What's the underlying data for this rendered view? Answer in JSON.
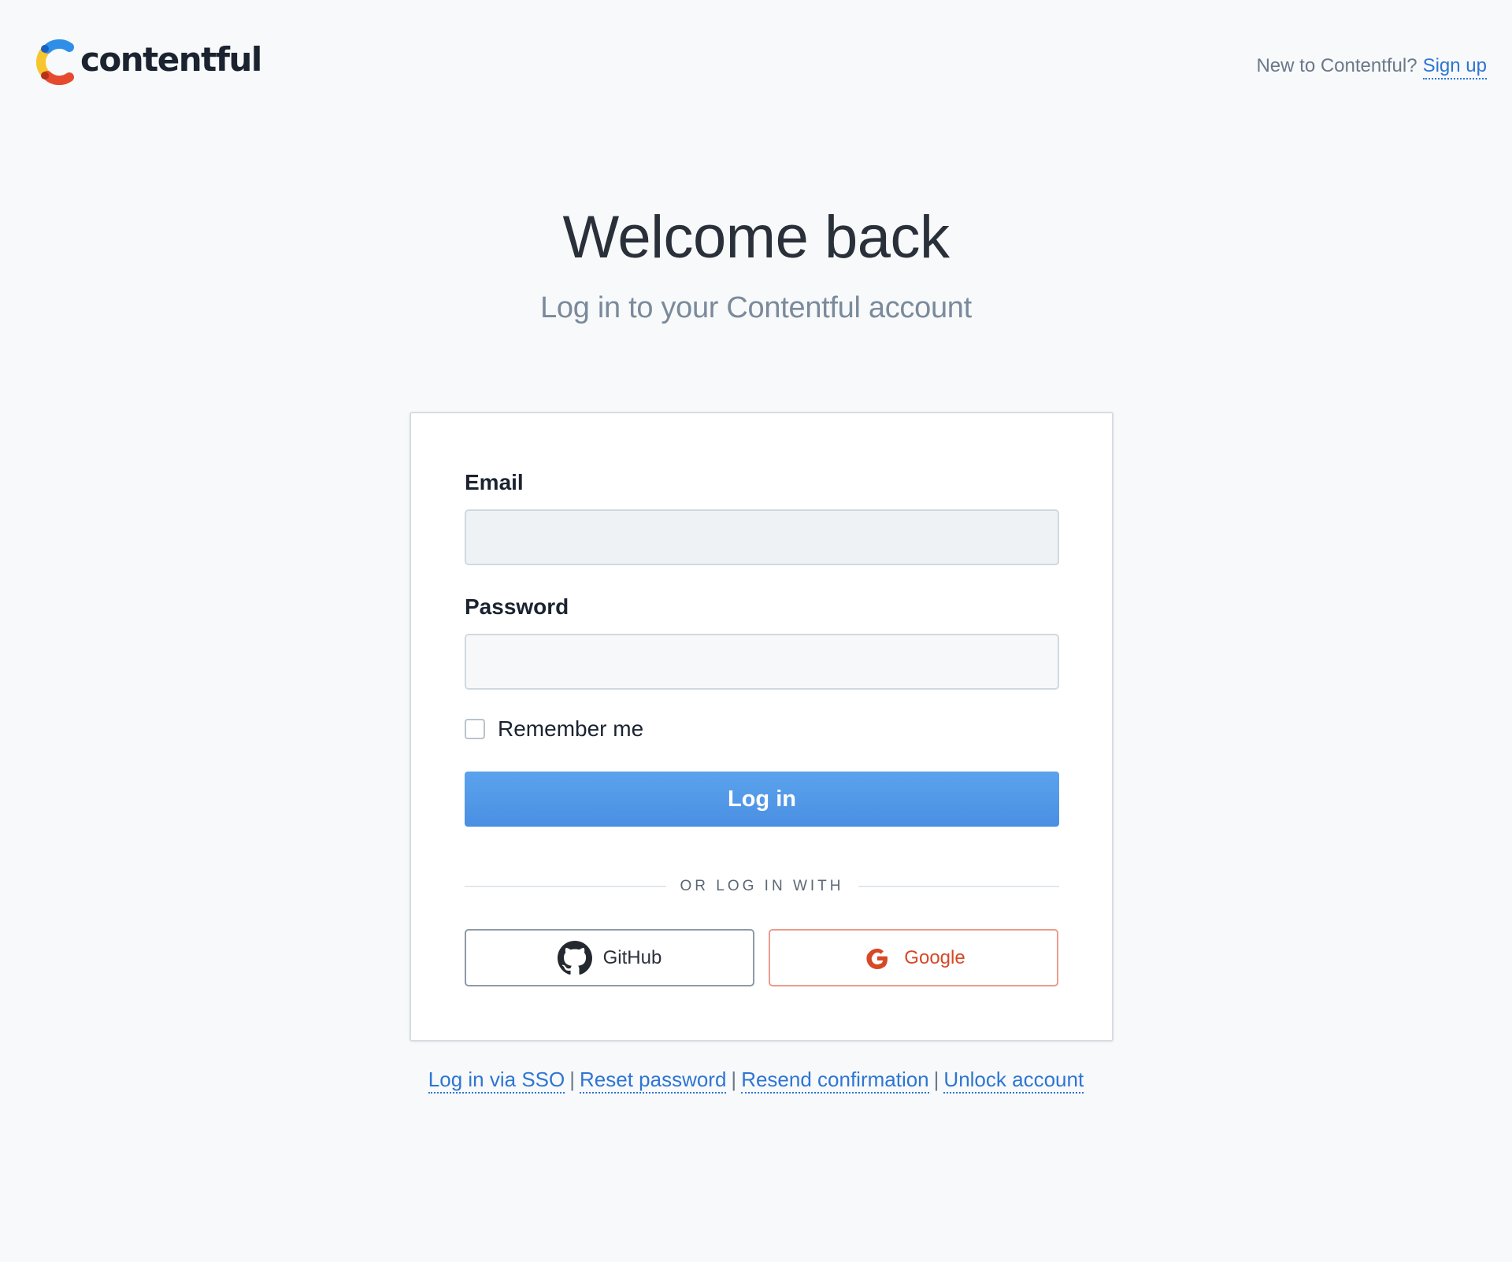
{
  "header": {
    "logo_text": "contentful",
    "signup_prompt": "New to Contentful?",
    "signup_link": "Sign up"
  },
  "main": {
    "title": "Welcome back",
    "subtitle": "Log in to your Contentful account"
  },
  "form": {
    "email_label": "Email",
    "email_value": "",
    "password_label": "Password",
    "password_value": "",
    "remember_label": "Remember me",
    "remember_checked": false,
    "login_button": "Log in",
    "divider_text": "OR LOG IN WITH",
    "github_label": "GitHub",
    "google_label": "Google"
  },
  "footer": {
    "links": [
      "Log in via SSO",
      "Reset password",
      "Resend confirmation",
      "Unlock account"
    ],
    "separator": "|"
  },
  "colors": {
    "background": "#f7f9fa",
    "link": "#2e75d4",
    "primary_button": "#4a8fe2",
    "google": "#d64826",
    "logo_blue": "#2f8ee8",
    "logo_yellow": "#f7c52e",
    "logo_red": "#e64a2e"
  },
  "icons": {
    "logo": "contentful-logo-icon",
    "github": "github-icon",
    "google": "google-icon"
  }
}
